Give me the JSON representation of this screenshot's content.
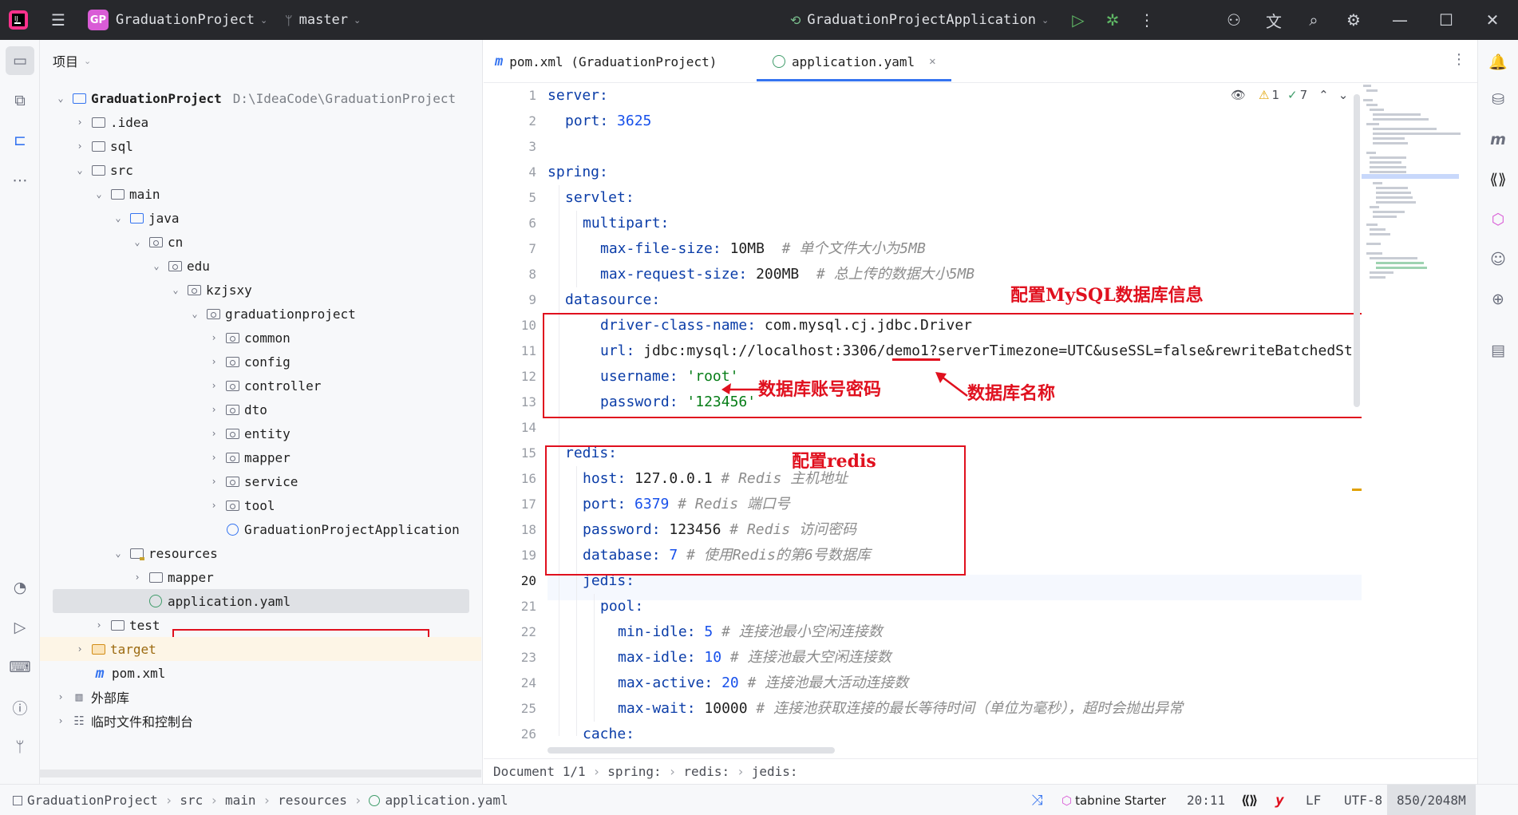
{
  "titlebar": {
    "project_badge": "GP",
    "project_name": "GraduationProject",
    "branch": "master",
    "run_config": "GraduationProjectApplication"
  },
  "project_panel": {
    "title": "项目",
    "root_name": "GraduationProject",
    "root_path": "D:\\IdeaCode\\GraduationProject",
    "items": [
      {
        "label": ".idea"
      },
      {
        "label": "sql"
      },
      {
        "label": "src"
      },
      {
        "label": "main"
      },
      {
        "label": "java"
      },
      {
        "label": "cn"
      },
      {
        "label": "edu"
      },
      {
        "label": "kzjsxy"
      },
      {
        "label": "graduationproject"
      },
      {
        "label": "common"
      },
      {
        "label": "config"
      },
      {
        "label": "controller"
      },
      {
        "label": "dto"
      },
      {
        "label": "entity"
      },
      {
        "label": "mapper"
      },
      {
        "label": "service"
      },
      {
        "label": "tool"
      },
      {
        "label": "GraduationProjectApplication"
      },
      {
        "label": "resources"
      },
      {
        "label": "mapper"
      },
      {
        "label": "application.yaml"
      },
      {
        "label": "test"
      },
      {
        "label": "target"
      },
      {
        "label": "pom.xml"
      },
      {
        "label": "外部库"
      },
      {
        "label": "临时文件和控制台"
      }
    ]
  },
  "tabs": [
    {
      "label": "pom.xml (GraduationProject)"
    },
    {
      "label": "application.yaml"
    }
  ],
  "inspections": {
    "warnings": "1",
    "ok": "7"
  },
  "code_lines": [
    {
      "n": "1",
      "key": "server:",
      "val": "",
      "cmt": ""
    },
    {
      "n": "2",
      "key": "port:",
      "val": "3625",
      "cmt": ""
    },
    {
      "n": "3",
      "key": "",
      "val": "",
      "cmt": ""
    },
    {
      "n": "4",
      "key": "spring:",
      "val": "",
      "cmt": ""
    },
    {
      "n": "5",
      "key": "servlet:",
      "val": "",
      "cmt": ""
    },
    {
      "n": "6",
      "key": "multipart:",
      "val": "",
      "cmt": ""
    },
    {
      "n": "7",
      "key": "max-file-size:",
      "val": "10MB",
      "cmt": "# 单个文件大小为5MB"
    },
    {
      "n": "8",
      "key": "max-request-size:",
      "val": "200MB",
      "cmt": "# 总上传的数据大小5MB"
    },
    {
      "n": "9",
      "key": "datasource:",
      "val": "",
      "cmt": ""
    },
    {
      "n": "10",
      "key": "driver-class-name:",
      "val": "com.mysql.cj.jdbc.Driver",
      "cmt": ""
    },
    {
      "n": "11",
      "key": "url:",
      "val": "jdbc:mysql://localhost:3306/demo1?serverTimezone=UTC&useSSL=false&rewriteBatchedSt",
      "cmt": ""
    },
    {
      "n": "12",
      "key": "username:",
      "val": "'root'",
      "cmt": ""
    },
    {
      "n": "13",
      "key": "password:",
      "val": "'123456'",
      "cmt": ""
    },
    {
      "n": "14",
      "key": "",
      "val": "",
      "cmt": ""
    },
    {
      "n": "15",
      "key": "redis:",
      "val": "",
      "cmt": ""
    },
    {
      "n": "16",
      "key": "host:",
      "val": "127.0.0.1",
      "cmt": "# Redis 主机地址"
    },
    {
      "n": "17",
      "key": "port:",
      "val": "6379",
      "cmt": "# Redis 端口号"
    },
    {
      "n": "18",
      "key": "password:",
      "val": "123456",
      "cmt": "# Redis 访问密码"
    },
    {
      "n": "19",
      "key": "database:",
      "val": "7",
      "cmt": "# 使用Redis的第6号数据库"
    },
    {
      "n": "20",
      "key": "jedis:",
      "val": "",
      "cmt": ""
    },
    {
      "n": "21",
      "key": "pool:",
      "val": "",
      "cmt": ""
    },
    {
      "n": "22",
      "key": "min-idle:",
      "val": "5",
      "cmt": "# 连接池最小空闲连接数"
    },
    {
      "n": "23",
      "key": "max-idle:",
      "val": "10",
      "cmt": "# 连接池最大空闲连接数"
    },
    {
      "n": "24",
      "key": "max-active:",
      "val": "20",
      "cmt": "# 连接池最大活动连接数"
    },
    {
      "n": "25",
      "key": "max-wait:",
      "val": "10000",
      "cmt": "# 连接池获取连接的最长等待时间（单位为毫秒），超时会抛出异常"
    },
    {
      "n": "26",
      "key": "cache:",
      "val": "",
      "cmt": ""
    }
  ],
  "annotations": {
    "mysql": "配置MySQL数据库信息",
    "account": "数据库账号密码",
    "dbname": "数据库名称",
    "redis": "配置redis"
  },
  "editor_breadcrumb": [
    "Document 1/1",
    "spring:",
    "redis:",
    "jedis:"
  ],
  "statusbar": {
    "path": [
      "GraduationProject",
      "src",
      "main",
      "resources",
      "application.yaml"
    ],
    "tabnine": "tabnine Starter",
    "position": "20:11",
    "line_sep": "LF",
    "encoding": "UTF-8",
    "memory": "850/2048M"
  },
  "colors": {
    "accent": "#3574f0",
    "annotation_red": "#e0101e",
    "titlebar_bg": "#27282c"
  }
}
